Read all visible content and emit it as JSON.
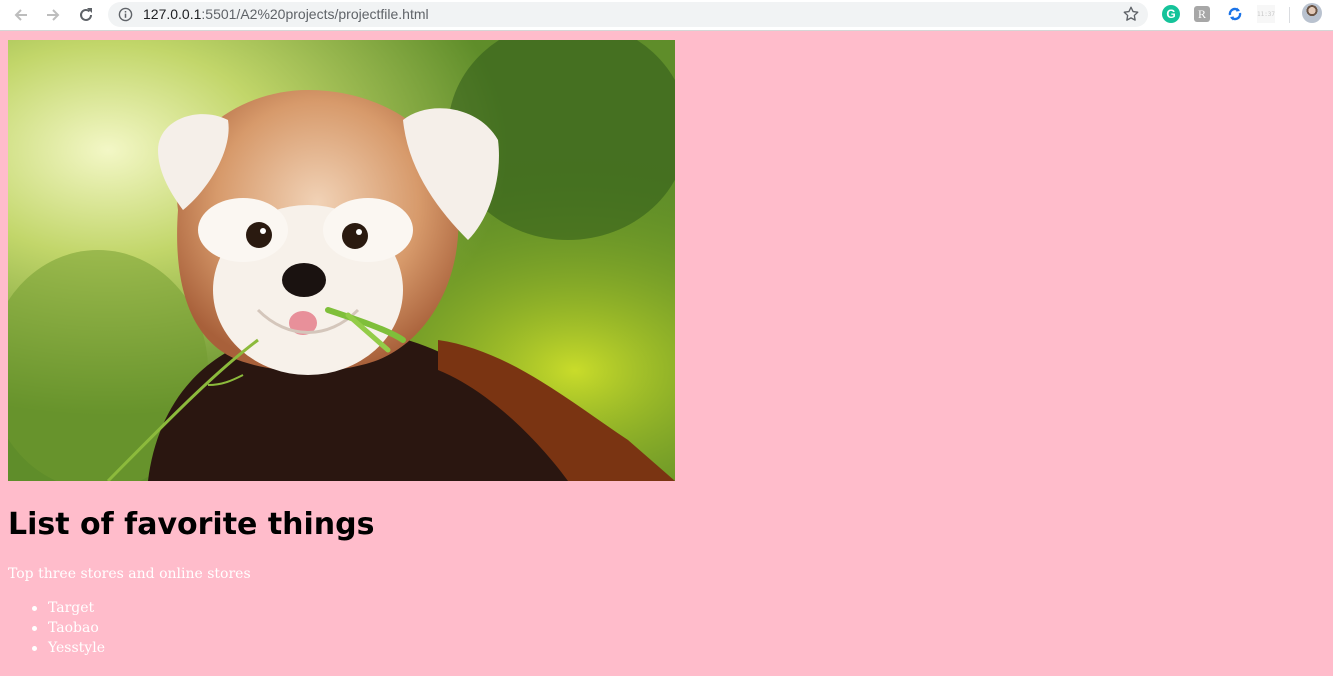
{
  "browser": {
    "url_host": "127.0.0.1",
    "url_rest": ":5501/A2%20projects/projectfile.html",
    "extension_timer_label": "11:37",
    "extension_r_label": "R",
    "extension_g_label": "G"
  },
  "page": {
    "image_alt": "red panda eating bamboo",
    "heading": "List of favorite things",
    "subtitle": "Top three stores and online stores",
    "stores": [
      "Target",
      "Taobao",
      "Yesstyle"
    ],
    "background_color": "#ffbccb"
  },
  "icons": {
    "back": "back-arrow-icon",
    "forward": "forward-arrow-icon",
    "reload": "reload-icon",
    "info": "info-icon",
    "star": "bookmark-star-icon",
    "grammarly": "grammarly-icon",
    "sync": "sync-icon"
  }
}
